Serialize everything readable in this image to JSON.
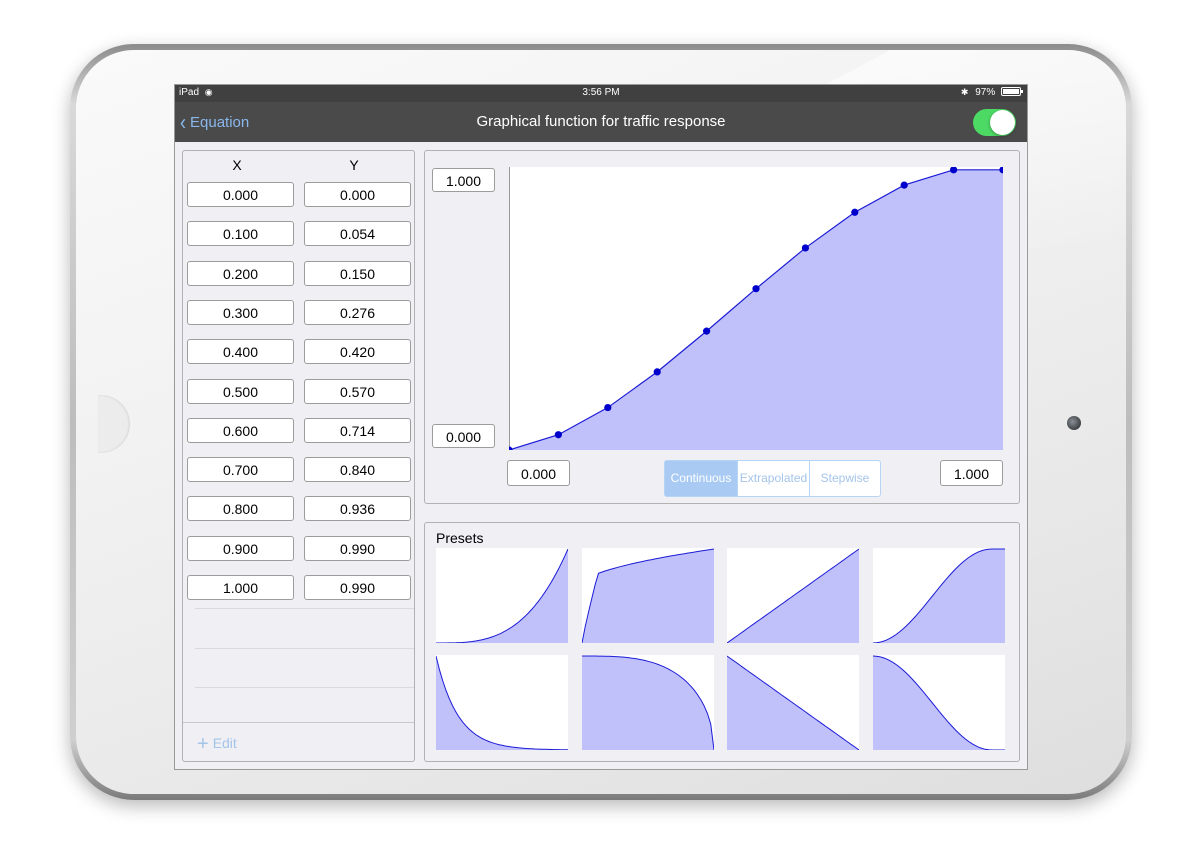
{
  "status_bar": {
    "device": "iPad",
    "time": "3:56 PM",
    "battery": "97%"
  },
  "nav": {
    "back_label": "Equation",
    "title": "Graphical function for traffic response",
    "toggle_on": true
  },
  "table": {
    "x_header": "X",
    "y_header": "Y",
    "rows": [
      {
        "x": "0.000",
        "y": "0.000"
      },
      {
        "x": "0.100",
        "y": "0.054"
      },
      {
        "x": "0.200",
        "y": "0.150"
      },
      {
        "x": "0.300",
        "y": "0.276"
      },
      {
        "x": "0.400",
        "y": "0.420"
      },
      {
        "x": "0.500",
        "y": "0.570"
      },
      {
        "x": "0.600",
        "y": "0.714"
      },
      {
        "x": "0.700",
        "y": "0.840"
      },
      {
        "x": "0.800",
        "y": "0.936"
      },
      {
        "x": "0.900",
        "y": "0.990"
      },
      {
        "x": "1.000",
        "y": "0.990"
      }
    ],
    "edit_label": "Edit"
  },
  "graph": {
    "y_max": "1.000",
    "y_min": "0.000",
    "x_min": "0.000",
    "x_max": "1.000",
    "modes": [
      "Continuous",
      "Extrapolated",
      "Stepwise"
    ],
    "active_mode": "Continuous"
  },
  "presets": {
    "title": "Presets"
  },
  "colors": {
    "fill": "#c0c0fa",
    "line": "#1b1bd6",
    "point": "#0000cc",
    "toggle": "#4cd964",
    "accent": "#8ab8ee"
  },
  "icons": [
    "chevron-left-icon",
    "wifi-icon",
    "bluetooth-icon",
    "battery-icon",
    "plus-icon"
  ],
  "chart_data": {
    "type": "area",
    "x": [
      0.0,
      0.1,
      0.2,
      0.3,
      0.4,
      0.5,
      0.6,
      0.7,
      0.8,
      0.9,
      1.0
    ],
    "y": [
      0.0,
      0.054,
      0.15,
      0.276,
      0.42,
      0.57,
      0.714,
      0.84,
      0.936,
      0.99,
      0.99
    ],
    "xlim": [
      0,
      1
    ],
    "ylim": [
      0,
      1
    ],
    "grid": false
  }
}
